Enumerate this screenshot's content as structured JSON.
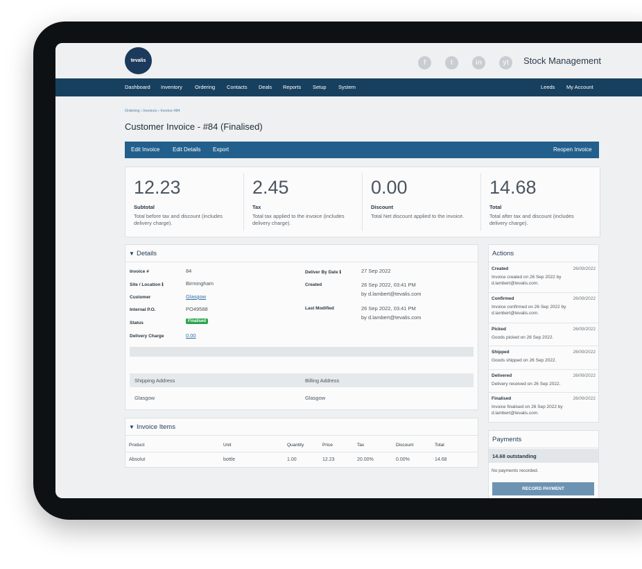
{
  "brand": {
    "logo_text": "tevalis",
    "app_name": "Stock Management"
  },
  "social_icons": [
    "f",
    "t",
    "in",
    "yt"
  ],
  "nav": {
    "items": [
      "Dashboard",
      "Inventory",
      "Ordering",
      "Contacts",
      "Deals",
      "Reports",
      "Setup",
      "System"
    ],
    "site": "Leeds",
    "account": "My Account"
  },
  "breadcrumb": "Ordering › Invoices › Invoice #84",
  "page_title": "Customer Invoice - #84 (Finalised)",
  "actions_bar": {
    "edit_invoice": "Edit Invoice",
    "edit_details": "Edit Details",
    "export": "Export",
    "reopen": "Reopen Invoice"
  },
  "summary": [
    {
      "value": "12.23",
      "label": "Subtotal",
      "desc": "Total before tax and discount (includes delivery charge)."
    },
    {
      "value": "2.45",
      "label": "Tax",
      "desc": "Total tax applied to the invoice (includes delivery charge)."
    },
    {
      "value": "0.00",
      "label": "Discount",
      "desc": "Total Net discount applied to the invoice."
    },
    {
      "value": "14.68",
      "label": "Total",
      "desc": "Total after tax and discount (includes delivery charge)."
    }
  ],
  "details": {
    "title": "Details",
    "invoice_label": "Invoice #",
    "invoice": "84",
    "site_label": "Site / Location",
    "site": "Birmingham",
    "customer_label": "Customer",
    "customer": "Glasgow",
    "po_label": "Internal P.O.",
    "po": "PO49588",
    "status_label": "Status",
    "status": "Finalised",
    "delivery_charge_label": "Delivery Charge",
    "delivery_charge": "0.00",
    "deliver_by_label": "Deliver By Date",
    "deliver_by": "27 Sep 2022",
    "created_label": "Created",
    "created_date": "26 Sep 2022, 03:41 PM",
    "created_by": "by d.lambert@tevalis.com",
    "modified_label": "Last Modified",
    "modified_date": "26 Sep 2022, 03:41 PM",
    "modified_by": "by d.lambert@tevalis.com",
    "shipping_label": "Shipping Address",
    "shipping": "Glasgow",
    "billing_label": "Billing Address",
    "billing": "Glasgow"
  },
  "items": {
    "title": "Invoice Items",
    "headers": [
      "Product",
      "Unit",
      "Quantity",
      "Price",
      "Tax",
      "Discount",
      "Total"
    ],
    "rows": [
      [
        "Absolut",
        "bottle",
        "1.00",
        "12.23",
        "20.00%",
        "0.00%",
        "14.68"
      ]
    ]
  },
  "actions_panel": {
    "title": "Actions",
    "entries": [
      {
        "title": "Created",
        "date": "26/09/2022",
        "text": "Invoice created on 26 Sep 2022 by d.lambert@tevalis.com."
      },
      {
        "title": "Confirmed",
        "date": "26/09/2022",
        "text": "Invoice confirmed on 26 Sep 2022 by d.lambert@tevalis.com."
      },
      {
        "title": "Picked",
        "date": "26/09/2022",
        "text": "Goods picked on 26 Sep 2022."
      },
      {
        "title": "Shipped",
        "date": "26/09/2022",
        "text": "Goods shipped on 26 Sep 2022."
      },
      {
        "title": "Delivered",
        "date": "26/09/2022",
        "text": "Delivery received on 26 Sep 2022."
      },
      {
        "title": "Finalised",
        "date": "26/09/2022",
        "text": "Invoice finalised on 26 Sep 2022 by d.lambert@tevalis.com."
      }
    ]
  },
  "payments": {
    "title": "Payments",
    "outstanding": "14.68 outstanding",
    "none": "No payments recorded.",
    "button": "RECORD PAYMENT"
  }
}
